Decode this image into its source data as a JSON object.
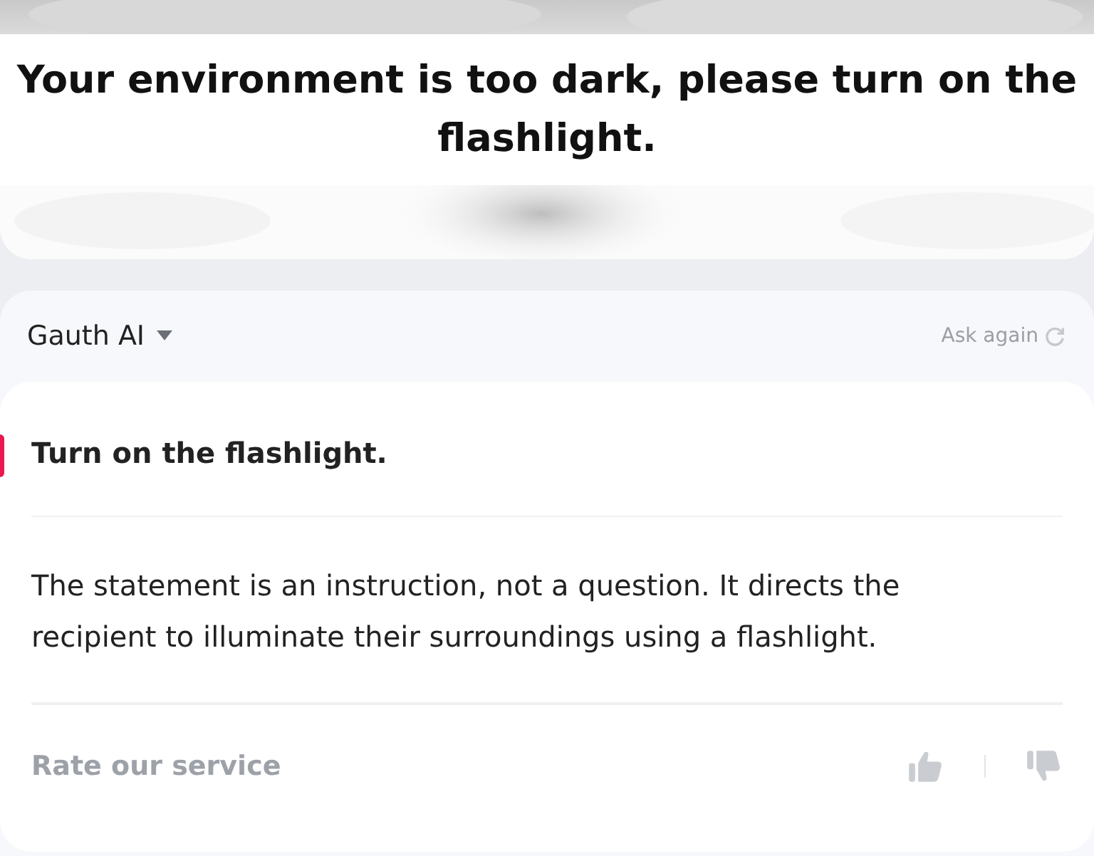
{
  "camera_view": {
    "kind": "picture",
    "notice": "Your environment is too dark, please turn on the flashlight."
  },
  "answer_panel": {
    "model": "Gauth AI",
    "ask_again": "Ask again",
    "question": "Turn on the flashlight.",
    "answer": "The statement is an instruction, not a question. It directs the recipient to illuminate their surroundings using a flashlight.",
    "rating_label": "Rate our service"
  }
}
